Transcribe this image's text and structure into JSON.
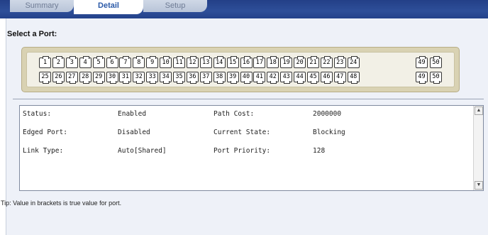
{
  "tabs": [
    {
      "label": "Summary",
      "active": false
    },
    {
      "label": "Detail",
      "active": true
    },
    {
      "label": "Setup",
      "active": false
    }
  ],
  "select_label": "Select a Port:",
  "ports": {
    "top_row": [
      "1",
      "2",
      "3",
      "4",
      "5",
      "6",
      "7",
      "8",
      "9",
      "10",
      "11",
      "12",
      "13",
      "14",
      "15",
      "16",
      "17",
      "18",
      "19",
      "20",
      "21",
      "22",
      "23",
      "24"
    ],
    "bottom_row": [
      "25",
      "26",
      "27",
      "28",
      "29",
      "30",
      "31",
      "32",
      "33",
      "34",
      "35",
      "36",
      "37",
      "38",
      "39",
      "40",
      "41",
      "42",
      "43",
      "44",
      "45",
      "46",
      "47",
      "48"
    ],
    "uplink_top": [
      "49",
      "50"
    ],
    "uplink_bottom": [
      "49",
      "50"
    ]
  },
  "details": {
    "status_label": "Status:",
    "status_value": "Enabled",
    "edged_port_label": "Edged Port:",
    "edged_port_value": "Disabled",
    "link_type_label": "Link Type:",
    "link_type_value": "Auto[Shared]",
    "path_cost_label": "Path Cost:",
    "path_cost_value": "2000000",
    "current_state_label": "Current State:",
    "current_state_value": "Blocking",
    "port_priority_label": "Port Priority:",
    "port_priority_value": "128"
  },
  "tip": "Tip: Value in brackets is true value for port.",
  "colors": {
    "tab_bar": "#2e4f99",
    "active_tab_text": "#2b5aa8",
    "panel_bg": "#eef1f8",
    "faceplate": "#d9d2b3"
  },
  "icons": {
    "scroll_up": "scroll-up-arrow-icon",
    "scroll_down": "scroll-down-arrow-icon"
  }
}
